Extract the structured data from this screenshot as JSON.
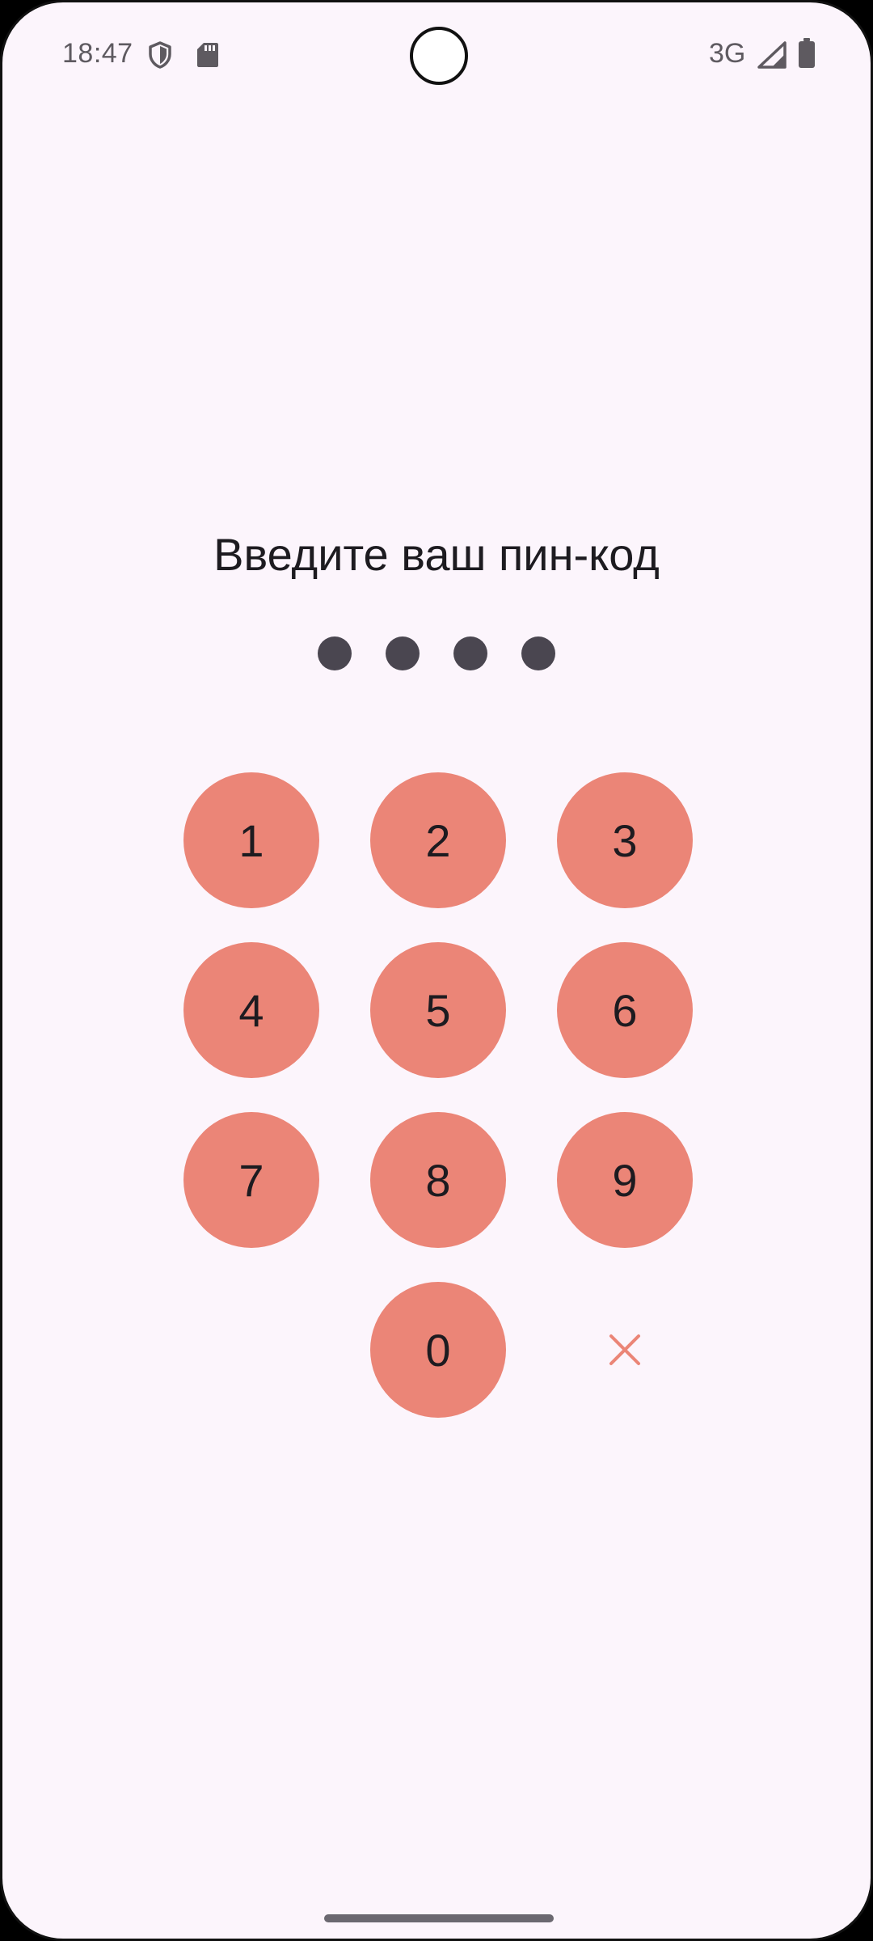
{
  "status_bar": {
    "time": "18:47",
    "network": "3G",
    "icons": [
      "shield-icon",
      "sd-card-icon",
      "signal-icon",
      "battery-icon"
    ]
  },
  "pin_screen": {
    "title": "Введите ваш пин-код",
    "entered_digits": 4,
    "keys": [
      {
        "label": "1"
      },
      {
        "label": "2"
      },
      {
        "label": "3"
      },
      {
        "label": "4"
      },
      {
        "label": "5"
      },
      {
        "label": "6"
      },
      {
        "label": "7"
      },
      {
        "label": "8"
      },
      {
        "label": "9"
      },
      {
        "label": "0"
      }
    ],
    "delete_icon": "close-icon"
  },
  "colors": {
    "background": "#FCF5FC",
    "key_fill": "#EB8577",
    "dot_fill": "#4A4650",
    "text": "#1D1B20"
  }
}
